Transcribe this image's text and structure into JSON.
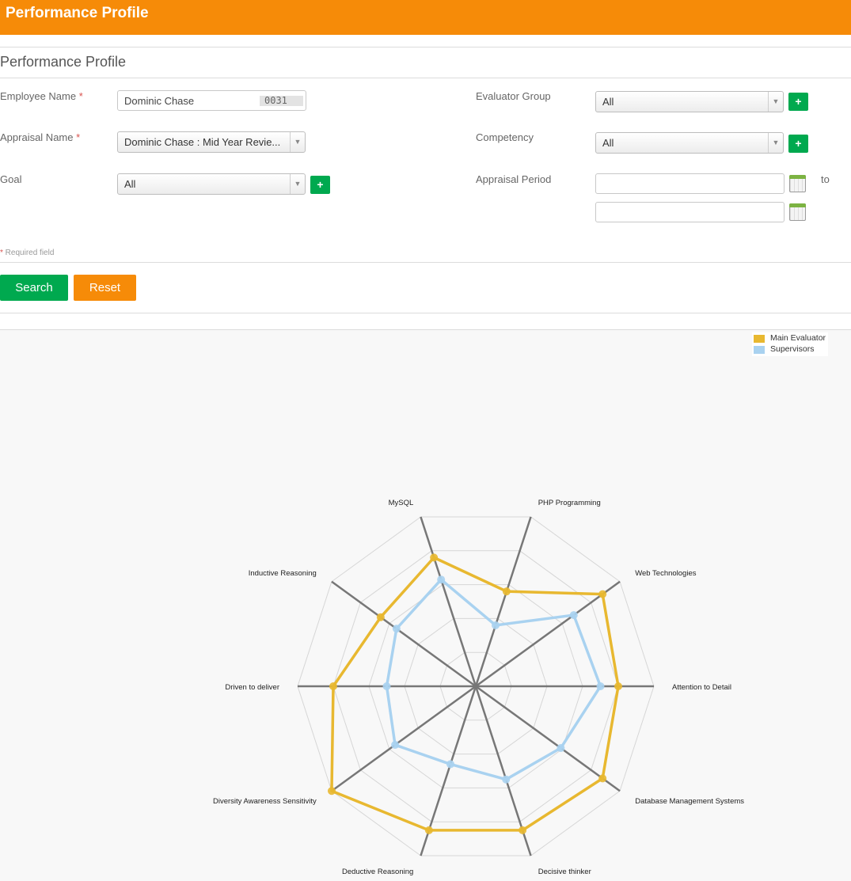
{
  "header": {
    "title": "Performance Profile"
  },
  "form": {
    "title": "Performance Profile",
    "employee_name": {
      "label": "Employee Name",
      "required_mark": "*",
      "value": "Dominic Chase",
      "id": "0031"
    },
    "appraisal_name": {
      "label": "Appraisal Name",
      "required_mark": "*",
      "value": "Dominic Chase : Mid Year Revie..."
    },
    "goal": {
      "label": "Goal",
      "value": "All"
    },
    "evaluator_group": {
      "label": "Evaluator Group",
      "value": "All"
    },
    "competency": {
      "label": "Competency",
      "value": "All"
    },
    "appraisal_period": {
      "label": "Appraisal Period",
      "from": "",
      "to": "",
      "to_label": "to"
    },
    "add_label": "+",
    "required_note": {
      "mark": "*",
      "text": " Required field"
    }
  },
  "buttons": {
    "search": "Search",
    "reset": "Reset"
  },
  "colors": {
    "header": "#f68b08",
    "search": "#00a94f",
    "reset": "#f68b08",
    "main_evaluator": "#e8b830",
    "supervisors": "#a9d2f0"
  },
  "chart_data": {
    "type": "radar",
    "axes": [
      "MySQL",
      "PHP Programming",
      "Web Technologies",
      "Attention to Detail",
      "Database Management Systems",
      "Decisive thinker",
      "Deductive Reasoning",
      "Diversity Awareness Sensitivity",
      "Driven to deliver",
      "Inductive Reasoning"
    ],
    "rmax": 100,
    "rings": 5,
    "series": [
      {
        "name": "Main Evaluator",
        "values": [
          76,
          56,
          88,
          80,
          88,
          85,
          85,
          100,
          80,
          66
        ]
      },
      {
        "name": "Supervisors",
        "values": [
          63,
          36,
          68,
          70,
          59,
          55,
          46,
          56,
          50,
          55
        ]
      }
    ]
  }
}
